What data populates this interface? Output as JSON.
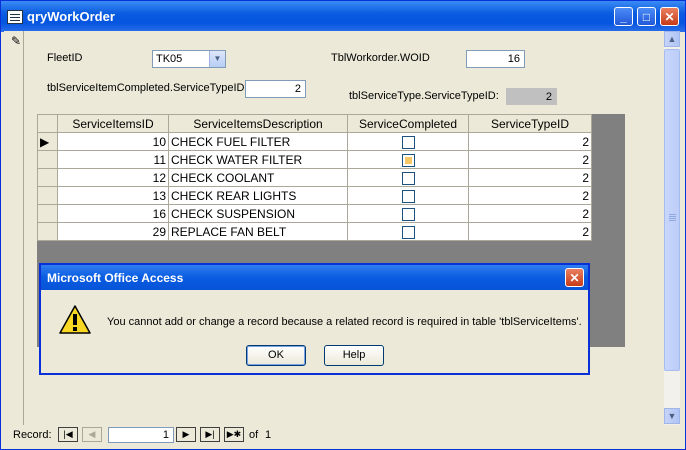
{
  "window": {
    "title": "qryWorkOrder"
  },
  "form": {
    "fleetid_label": "FleetID",
    "fleetid_value": "TK05",
    "woid_label": "TblWorkorder.WOID",
    "woid_value": "16",
    "sic_label": "tblServiceItemCompleted.ServiceTypeID",
    "sic_value": "2",
    "st_label": "tblServiceType.ServiceTypeID:",
    "st_value": "2"
  },
  "grid": {
    "columns": [
      "ServiceItemsID",
      "ServiceItemsDescription",
      "ServiceCompleted",
      "ServiceTypeID"
    ],
    "rows": [
      {
        "id": "10",
        "desc": "CHECK FUEL FILTER",
        "completed": false,
        "type": "2"
      },
      {
        "id": "11",
        "desc": "CHECK WATER FILTER",
        "completed": false,
        "type": "2"
      },
      {
        "id": "12",
        "desc": "CHECK COOLANT",
        "completed": false,
        "type": "2"
      },
      {
        "id": "13",
        "desc": "CHECK REAR LIGHTS",
        "completed": false,
        "type": "2"
      },
      {
        "id": "16",
        "desc": "CHECK SUSPENSION",
        "completed": false,
        "type": "2"
      },
      {
        "id": "29",
        "desc": "REPLACE FAN BELT",
        "completed": false,
        "type": "2"
      }
    ]
  },
  "nav": {
    "record_label": "Record:",
    "current": "1",
    "of_label": "of",
    "total": "1"
  },
  "dialog": {
    "title": "Microsoft Office Access",
    "message": "You cannot add or change a record because a related record is required in table 'tblServiceItems'.",
    "ok_label": "OK",
    "help_label": "Help",
    "close_label": "✕"
  },
  "icons": {
    "window": "form-icon",
    "warning": "warning-icon",
    "pencil": "pencil-icon"
  },
  "colors": {
    "titlebar": "#0a5ce0",
    "dialog_border": "#0831d9",
    "grid_bg": "#808080"
  }
}
